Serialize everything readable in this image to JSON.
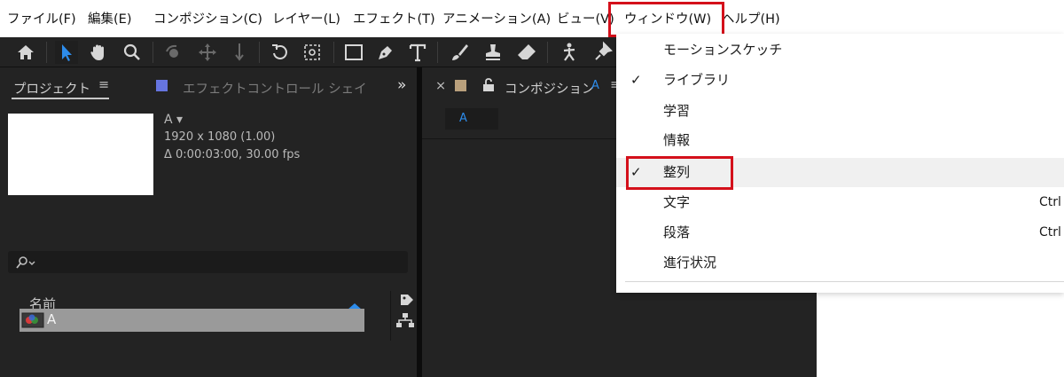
{
  "menubar": {
    "items": [
      "ファイル(F)",
      "編集(E)",
      "コンポジション(C)",
      "レイヤー(L)",
      "エフェクト(T)",
      "アニメーション(A)",
      "ビュー(V)",
      "ウィンドウ(W)",
      "ヘルプ(H)"
    ]
  },
  "project_panel": {
    "tab_label": "プロジェクト",
    "tab_menu": "≡",
    "effect_tab_label": "エフェクトコントロール シェイプレ",
    "overflow": "»",
    "comp_name": "A ▾",
    "resolution": "1920 x 1080 (1.00)",
    "duration": "Δ 0:00:03:00, 30.00 fps",
    "search_placeholder": "",
    "column_name": "名前",
    "rows": [
      {
        "name": "A"
      }
    ]
  },
  "comp_panel": {
    "close": "×",
    "tab_label": "コンポジション",
    "tab_comp": "A",
    "tab_menu": "≡",
    "sub_tab": "A"
  },
  "window_menu": {
    "items": [
      {
        "label": "モーションスケッチ",
        "checked": false,
        "shortcut": ""
      },
      {
        "label": "ライブラリ",
        "checked": true,
        "shortcut": ""
      },
      {
        "label": "学習",
        "checked": false,
        "shortcut": ""
      },
      {
        "label": "情報",
        "checked": false,
        "shortcut": ""
      },
      {
        "label": "整列",
        "checked": true,
        "shortcut": ""
      },
      {
        "label": "文字",
        "checked": false,
        "shortcut": "Ctrl"
      },
      {
        "label": "段落",
        "checked": false,
        "shortcut": "Ctrl"
      },
      {
        "label": "進行状況",
        "checked": false,
        "shortcut": ""
      }
    ],
    "check_glyph": "✓"
  },
  "colors": {
    "highlight_box": "#d4101b",
    "app_background": "#232323",
    "accent_blue": "#2d8ceb",
    "label_blue": "#6675e0",
    "label_tan": "#b9a07c"
  }
}
